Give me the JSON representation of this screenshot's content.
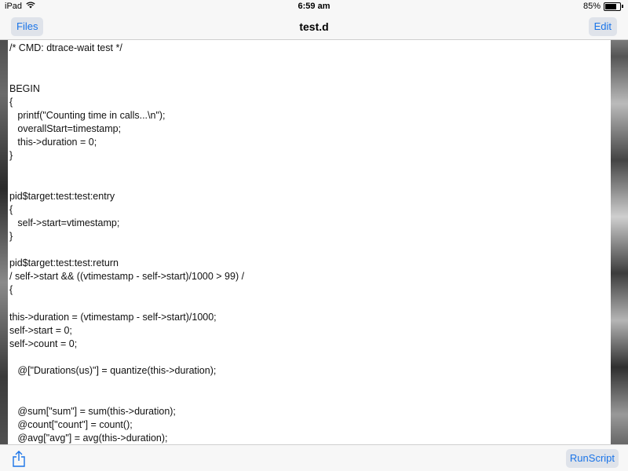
{
  "status_bar": {
    "device": "iPad",
    "time": "6:59 am",
    "battery_text": "85%",
    "battery_level": 0.85
  },
  "nav": {
    "left_button": "Files",
    "title": "test.d",
    "right_button": "Edit"
  },
  "editor": {
    "lines": [
      "/* CMD: dtrace-wait test */",
      "BEGIN",
      "{",
      "   printf(\"Counting time in calls...\\n\");",
      "   overallStart=timestamp;",
      "   this->duration = 0;",
      "}",
      "pid$target:test:test:entry",
      "{",
      "   self->start=vtimestamp;",
      "}",
      "pid$target:test:test:return",
      "/ self->start && ((vtimestamp - self->start)/1000 > 99) /",
      "{",
      "this->duration = (vtimestamp - self->start)/1000;",
      "self->start = 0;",
      "self->count = 0;",
      "   @[\"Durations(us)\"] = quantize(this->duration);",
      "   @sum[\"sum\"] = sum(this->duration);",
      "   @count[\"count\"] = count();",
      "   @avg[\"avg\"] = avg(this->duration);"
    ]
  },
  "toolbar": {
    "run_button": "RunScript"
  },
  "icons": {
    "share": "share-icon",
    "wifi": "wifi-icon",
    "battery": "battery-icon"
  },
  "colors": {
    "accent": "#1a74e8",
    "button_bg": "#dfe3ea",
    "bar_bg": "#f7f7f7"
  }
}
